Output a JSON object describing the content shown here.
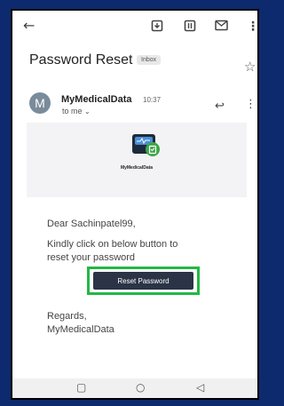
{
  "toolbar": {
    "back_icon": "arrow-left-icon",
    "archive_icon": "archive-icon",
    "delete_icon": "delete-icon",
    "mail_icon": "mail-icon",
    "more_icon": "more-vert-icon"
  },
  "email": {
    "subject": "Password Reset",
    "label": "Inbox",
    "sender": {
      "avatar_letter": "M",
      "name": "MyMedicalData",
      "time": "10:37",
      "to": "to me"
    },
    "logo_text": "MyMedicalData",
    "greeting": "Dear Sachinpatel99,",
    "message_line1": "Kindly click on below button to",
    "message_line2": "reset your password",
    "button_label": "Reset Password",
    "regards": "Regards,",
    "signature": "MyMedicalData"
  },
  "colors": {
    "page_bg": "#0d2a6e",
    "button_bg": "#2a3446",
    "highlight": "#22b845"
  }
}
